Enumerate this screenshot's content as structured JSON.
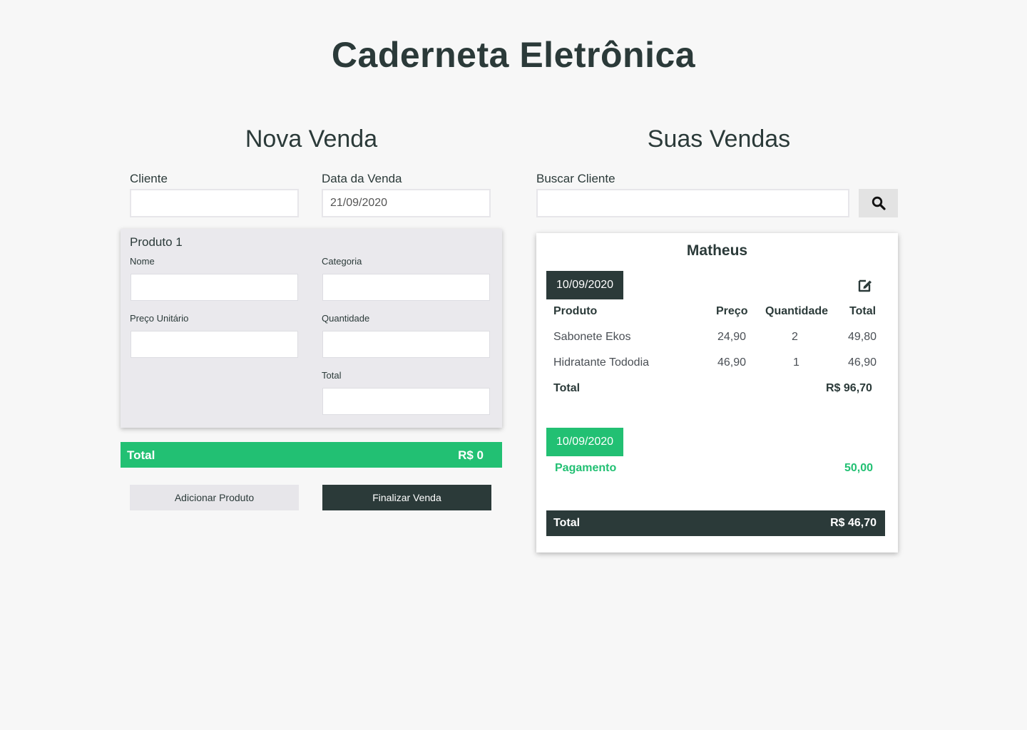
{
  "app": {
    "title": "Caderneta Eletrônica"
  },
  "nova_venda": {
    "title": "Nova Venda",
    "cliente_label": "Cliente",
    "cliente_value": "",
    "data_label": "Data da Venda",
    "data_value": "21/09/2020",
    "produto": {
      "heading": "Produto 1",
      "nome_label": "Nome",
      "categoria_label": "Categoria",
      "preco_label": "Preço Unitário",
      "quantidade_label": "Quantidade",
      "total_label": "Total"
    },
    "total_label": "Total",
    "total_value": "R$ 0",
    "add_button": "Adicionar Produto",
    "finish_button": "Finalizar Venda"
  },
  "suas_vendas": {
    "title": "Suas Vendas",
    "search_label": "Buscar Cliente",
    "search_value": "",
    "search_icon": "search-icon",
    "client": "Matheus",
    "sale": {
      "date": "10/09/2020",
      "edit_icon": "edit-icon",
      "columns": [
        "Produto",
        "Preço",
        "Quantidade",
        "Total"
      ],
      "rows": [
        {
          "produto": "Sabonete Ekos",
          "preco": "24,90",
          "quantidade": "2",
          "total": "49,80"
        },
        {
          "produto": "Hidratante Tododia",
          "preco": "46,90",
          "quantidade": "1",
          "total": "46,90"
        }
      ],
      "total_label": "Total",
      "total_value": "R$ 96,70"
    },
    "payment": {
      "date": "10/09/2020",
      "label": "Pagamento",
      "value": "50,00"
    },
    "balance_label": "Total",
    "balance_value": "R$ 46,70"
  },
  "colors": {
    "dark": "#2b3a39",
    "green": "#22c073",
    "card_gray": "#eae9ed",
    "background": "#f7f7f7"
  }
}
